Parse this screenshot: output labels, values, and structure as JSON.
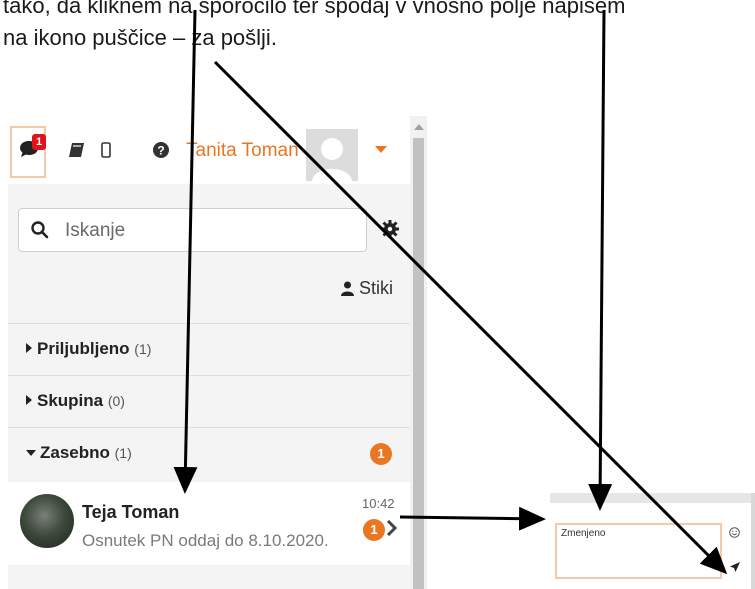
{
  "instruction": {
    "line1": "tako, da kliknem na sporočilo ter spodaj v vnosno polje napišem",
    "line2": "na ikono puščice – za pošlji."
  },
  "header": {
    "notification_count": "1",
    "user_name": "Tanita Toman"
  },
  "search": {
    "placeholder": "Iskanje"
  },
  "contacts": {
    "label": "Stiki"
  },
  "sections": [
    {
      "name": "Priljubljeno",
      "count": "(1)",
      "expanded": false
    },
    {
      "name": "Skupina",
      "count": "(0)",
      "expanded": false
    },
    {
      "name": "Zasebno",
      "count": "(1)",
      "expanded": true,
      "unread": "1"
    }
  ],
  "conversation": {
    "name": "Teja Toman",
    "preview": "Osnutek PN oddaj do 8.10.2020.",
    "time": "10:42",
    "unread": "1"
  },
  "composer": {
    "value": "Zmenjeno"
  },
  "colors": {
    "accent": "#e87722",
    "badge_red": "#e2121b",
    "focus_border": "#f3c9a8"
  },
  "icons": [
    "chat-icon",
    "book-icon",
    "mobile-icon",
    "help-icon",
    "search-icon",
    "gear-icon",
    "user-icon",
    "chevron-right-icon",
    "emoji-icon",
    "send-icon"
  ]
}
